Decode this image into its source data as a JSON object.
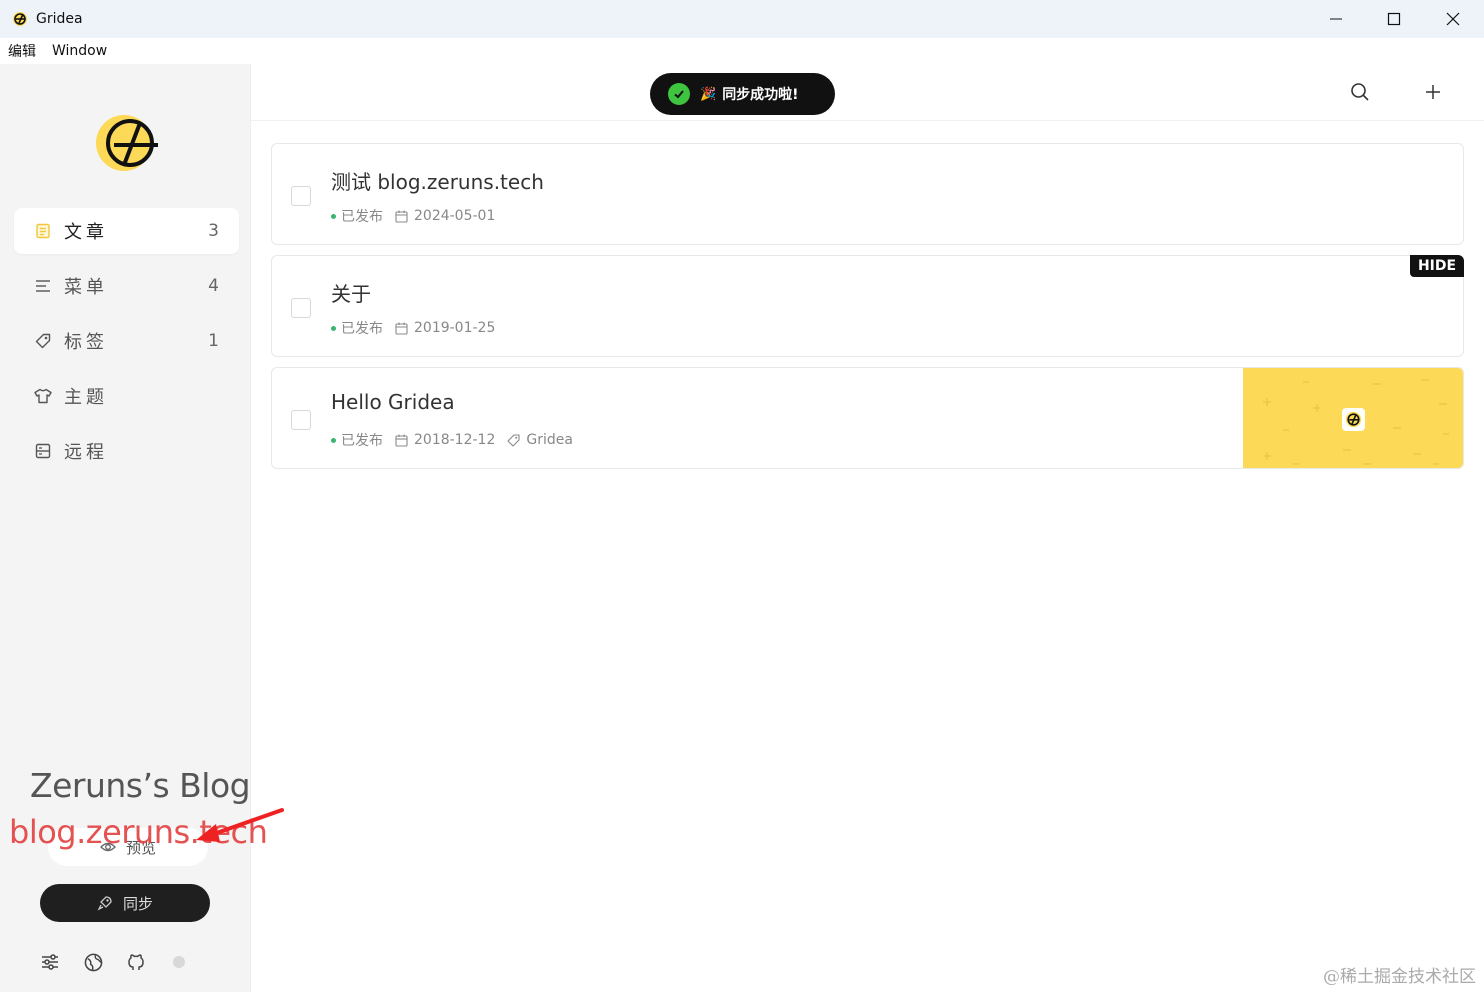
{
  "window": {
    "title": "Gridea"
  },
  "menubar": {
    "items": [
      "编辑",
      "Window"
    ]
  },
  "sidebar": {
    "nav": [
      {
        "label": "文章",
        "count": "3",
        "icon": "article-icon",
        "active": true
      },
      {
        "label": "菜单",
        "count": "4",
        "icon": "menu-icon",
        "active": false
      },
      {
        "label": "标签",
        "count": "1",
        "icon": "tag-icon",
        "active": false
      },
      {
        "label": "主题",
        "count": "",
        "icon": "shirt-icon",
        "active": false
      },
      {
        "label": "远程",
        "count": "",
        "icon": "remote-icon",
        "active": false
      }
    ],
    "preview_label": "预览",
    "sync_label": "同步"
  },
  "toast": {
    "emoji": "🎉",
    "text": "同步成功啦!"
  },
  "posts": [
    {
      "title": "测试 blog.zeruns.tech",
      "status": "已发布",
      "date": "2024-05-01",
      "tag": "",
      "hidden": false
    },
    {
      "title": "关于",
      "status": "已发布",
      "date": "2019-01-25",
      "tag": "",
      "hidden": true,
      "badge": "HIDE"
    },
    {
      "title": "Hello Gridea",
      "status": "已发布",
      "date": "2018-12-12",
      "tag": "Gridea",
      "hidden": false
    }
  ],
  "overlays": {
    "watermark_title": "Zeruns’s Blog",
    "watermark_url": "blog.zeruns.tech",
    "juejin": "@稀土掘金技术社区"
  },
  "colors": {
    "accent": "#fcd956",
    "published_dot": "#3cb371",
    "toast_bg": "#111111",
    "toast_check": "#3ec43e",
    "watermark_red": "#e23b3b"
  }
}
